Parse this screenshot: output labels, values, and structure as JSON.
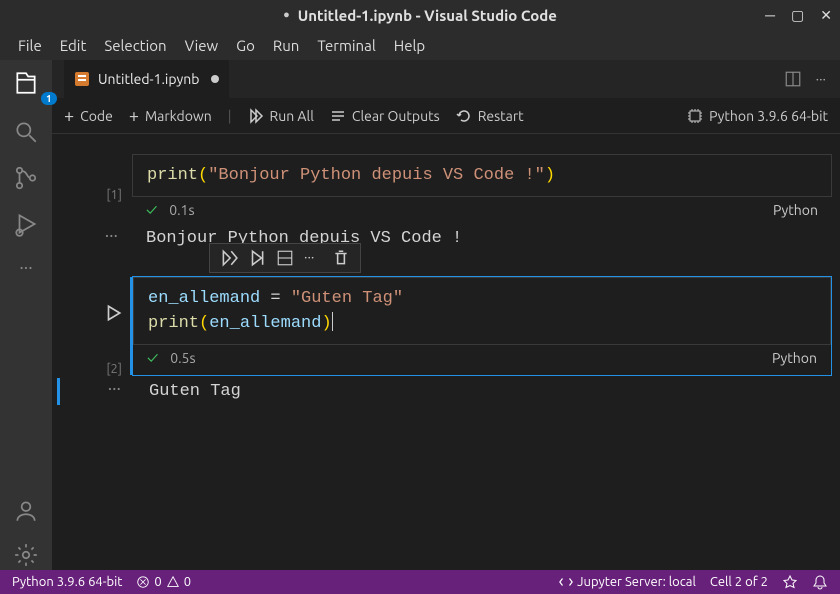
{
  "titlebar": {
    "dirty_indicator": "●",
    "title": "Untitled-1.ipynb - Visual Studio Code"
  },
  "menubar": [
    "File",
    "Edit",
    "Selection",
    "View",
    "Go",
    "Run",
    "Terminal",
    "Help"
  ],
  "activitybar": {
    "badge": "1"
  },
  "tab": {
    "filename": "Untitled-1.ipynb"
  },
  "nbtoolbar": {
    "code": "Code",
    "markdown": "Markdown",
    "runall": "Run All",
    "clear": "Clear Outputs",
    "restart": "Restart",
    "kernel": "Python 3.9.6 64-bit"
  },
  "cells": [
    {
      "count": "[1]",
      "time": "0.1s",
      "lang": "Python",
      "output_ellipsis": "···",
      "output": "Bonjour Python depuis VS Code !",
      "code": {
        "fn": "print",
        "po": "(",
        "str": "\"Bonjour Python depuis VS Code !\"",
        "pc": ")"
      }
    },
    {
      "count": "[2]",
      "time": "0.5s",
      "lang": "Python",
      "output_ellipsis": "···",
      "output": "Guten Tag",
      "code": {
        "l1": {
          "var": "en_allemand",
          "op": " = ",
          "str": "\"Guten Tag\""
        },
        "l2": {
          "fn": "print",
          "po": "(",
          "var": "en_allemand",
          "pc": ")"
        }
      }
    }
  ],
  "statusbar": {
    "python": "Python 3.9.6 64-bit",
    "errors": "0",
    "warnings": "0",
    "jupyter": "Jupyter Server: local",
    "cell": "Cell 2 of 2"
  }
}
